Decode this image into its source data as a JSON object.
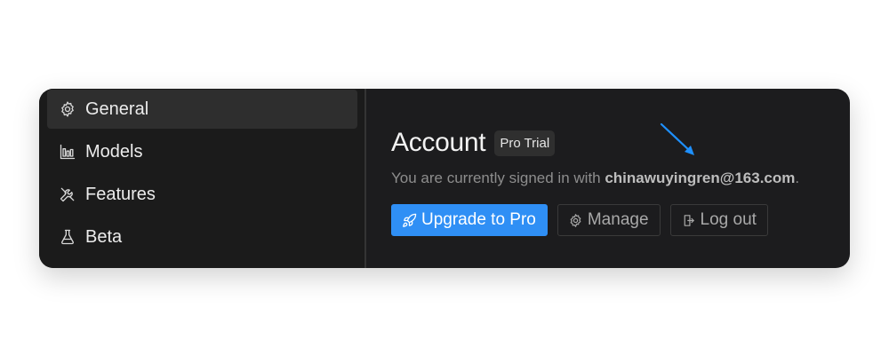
{
  "sidebar": {
    "items": [
      {
        "label": "General",
        "icon": "gear-icon",
        "active": true
      },
      {
        "label": "Models",
        "icon": "bar-chart-icon",
        "active": false
      },
      {
        "label": "Features",
        "icon": "tools-icon",
        "active": false
      },
      {
        "label": "Beta",
        "icon": "flask-icon",
        "active": false
      }
    ]
  },
  "account": {
    "title": "Account",
    "plan_badge": "Pro Trial",
    "signed_in_prefix": "You are currently signed in with ",
    "email": "chinawuyingren@163.com",
    "signed_in_suffix": "."
  },
  "buttons": {
    "upgrade_label": "Upgrade to Pro",
    "manage_label": "Manage",
    "logout_label": "Log out"
  },
  "colors": {
    "accent": "#2f8ff5",
    "window_bg": "#1c1c1e",
    "sidebar_active_bg": "#2e2e2e",
    "annotation_arrow": "#1e90ff"
  }
}
